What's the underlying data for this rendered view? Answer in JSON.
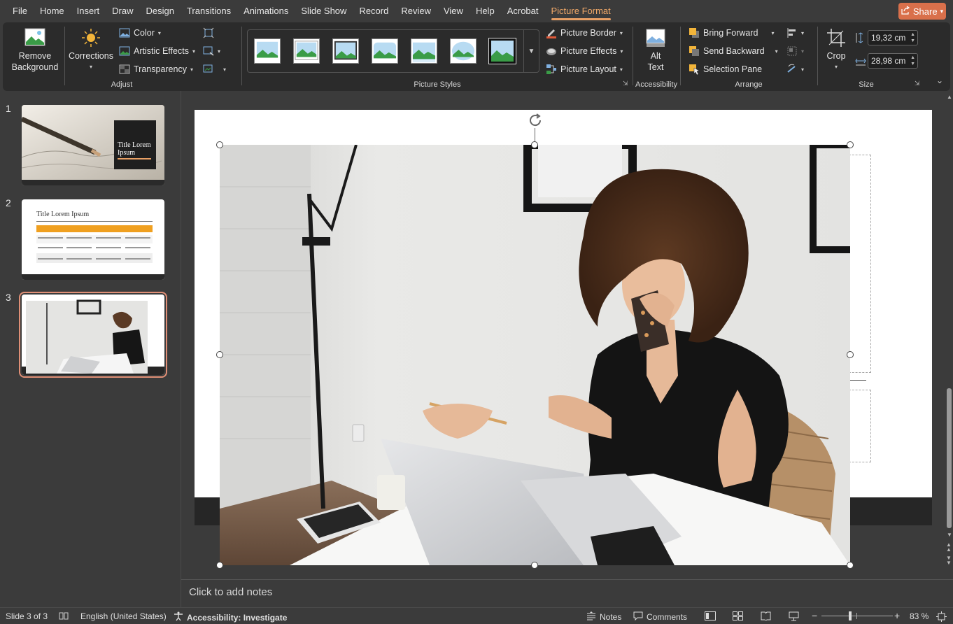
{
  "menu": {
    "tabs": [
      "File",
      "Home",
      "Insert",
      "Draw",
      "Design",
      "Transitions",
      "Animations",
      "Slide Show",
      "Record",
      "Review",
      "View",
      "Help",
      "Acrobat",
      "Picture Format"
    ],
    "active_tab": "Picture Format",
    "share_label": "Share"
  },
  "ribbon": {
    "adjust": {
      "label": "Adjust",
      "remove_background_line1": "Remove",
      "remove_background_line2": "Background",
      "corrections": "Corrections",
      "color": "Color",
      "artistic_effects": "Artistic Effects",
      "transparency": "Transparency"
    },
    "picture_styles": {
      "label": "Picture Styles",
      "picture_border": "Picture Border",
      "picture_effects": "Picture Effects",
      "picture_layout": "Picture Layout"
    },
    "accessibility": {
      "label": "Accessibility",
      "alt_text_line1": "Alt",
      "alt_text_line2": "Text"
    },
    "arrange": {
      "label": "Arrange",
      "bring_forward": "Bring Forward",
      "send_backward": "Send Backward",
      "selection_pane": "Selection Pane"
    },
    "size": {
      "label": "Size",
      "crop": "Crop",
      "height": "19,32 cm",
      "width": "28,98 cm"
    }
  },
  "slides": {
    "numbers": [
      "1",
      "2",
      "3"
    ],
    "slide1_title": "Title Lorem Ipsum",
    "slide2_title": "Title Lorem Ipsum",
    "selected": 3
  },
  "notes": {
    "placeholder": "Click to add notes"
  },
  "status": {
    "slide_info": "Slide 3 of 3",
    "language": "English (United States)",
    "accessibility": "Accessibility: Investigate",
    "notes": "Notes",
    "comments": "Comments",
    "zoom": "83 %",
    "zoom_level": 0.83
  },
  "colors": {
    "accent": "#e8a065",
    "share": "#d9704b",
    "ribbon_bg": "#2b2b2b",
    "app_bg": "#3b3b3b",
    "slide_footer": "#262626",
    "table_orange": "#f0a020"
  }
}
